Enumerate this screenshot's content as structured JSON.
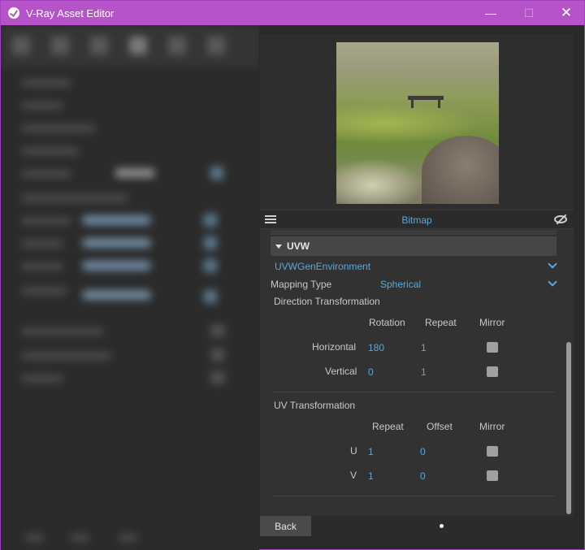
{
  "window": {
    "title": "V-Ray Asset Editor",
    "accent": "#b653c8",
    "minimize_symbol": "—",
    "maximize_symbol": "☐",
    "close_symbol": "✕"
  },
  "preview": {
    "label": "Bitmap",
    "label_color": "#5aa8dc",
    "list_icon": "list-icon",
    "visibility_icon": "eye-off-icon"
  },
  "uvw": {
    "section_title": "UVW",
    "generator": "UVWGenEnvironment",
    "mapping_type_label": "Mapping Type",
    "mapping_type_value": "Spherical",
    "direction": {
      "title": "Direction Transformation",
      "headers": [
        "Rotation",
        "Repeat",
        "Mirror"
      ],
      "rows": [
        {
          "label": "Horizontal",
          "rotation": "180",
          "repeat": "1",
          "mirror": false
        },
        {
          "label": "Vertical",
          "rotation": "0",
          "repeat": "1",
          "mirror": false
        }
      ]
    },
    "uv": {
      "title": "UV Transformation",
      "headers": [
        "Repeat",
        "Offset",
        "Mirror"
      ],
      "rows": [
        {
          "label": "U",
          "repeat": "1",
          "offset": "0",
          "mirror": false
        },
        {
          "label": "V",
          "repeat": "1",
          "offset": "0",
          "mirror": false
        }
      ]
    }
  },
  "footer": {
    "back_label": "Back"
  }
}
